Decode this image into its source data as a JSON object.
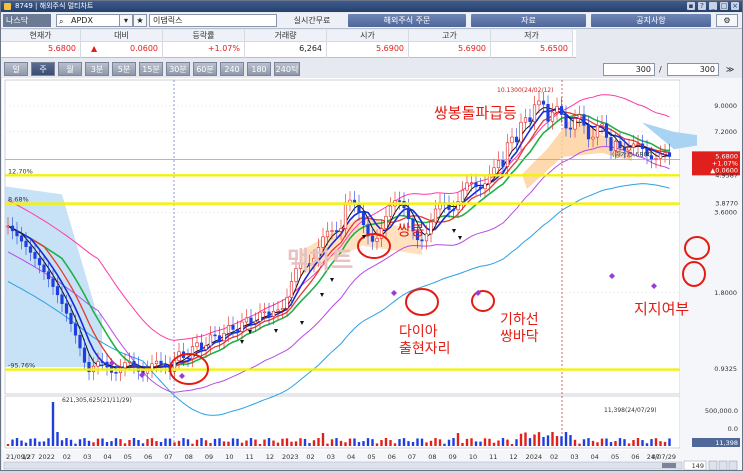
{
  "window": {
    "title": "8749 | 해외주식 멀티차트"
  },
  "toolbar": {
    "market": "나스닥",
    "symbol": "APDX",
    "name": "이댑릭스",
    "realtime_label": "실시간무료",
    "order_label": "해외주식 주문",
    "data_label": "자료",
    "notice_label": "공지사항"
  },
  "quote": {
    "headers": [
      "현재가",
      "대비",
      "등락률",
      "거래량",
      "시가",
      "고가",
      "저가"
    ],
    "values": [
      "5.6800",
      "0.0600",
      "+1.07%",
      "6,264",
      "5.6900",
      "5.6900",
      "5.6500"
    ]
  },
  "timeframes": [
    "일",
    "주",
    "월",
    "3분",
    "5분",
    "15분",
    "30분",
    "60분",
    "240분",
    "180틱",
    "240틱"
  ],
  "active_timeframe": "주",
  "count": {
    "left": "300",
    "sep": "/",
    "right": "300"
  },
  "chart": {
    "price_ticks": [
      "9.0000",
      "7.2000",
      "3.6000",
      "1.8000",
      "0.9325"
    ],
    "current_label": "5.6800",
    "current_label_2": "+1.07%",
    "current_label_3": "▲0.0600",
    "closing_note": "(종가)5.6800",
    "high_note": "10.1300(24/02/12)",
    "level_a": "4.9587",
    "level_b": "3.8770",
    "pct_top": "12.70%",
    "pct_mid": "8.68%",
    "pct_low": "-95.76%",
    "volume_ticks": [
      "500,000.0",
      "0.0"
    ],
    "volume_top_note": "621,305,625(21/11/29)",
    "volume_right_note": "11,398(24/07/29)",
    "volume_current": "11,398",
    "x_labels": [
      "21/09/27",
      "12",
      "2022",
      "02",
      "03",
      "04",
      "05",
      "06",
      "07",
      "08",
      "09",
      "10",
      "11",
      "12",
      "2023",
      "02",
      "03",
      "04",
      "05",
      "06",
      "07",
      "08",
      "09",
      "10",
      "11",
      "12",
      "2024",
      "02",
      "03",
      "04",
      "05",
      "06",
      "07",
      "24/07/29"
    ],
    "page_value": "149",
    "watermark": "맥차트",
    "annotations": {
      "surge": "쌍봉돌파급등",
      "double_top": "쌍봉",
      "diamond": "다이아\n출현자리",
      "double_bottom": "기하선\n쌍바닥",
      "support": "지지여부"
    },
    "colors": {
      "up": "#e0201c",
      "down": "#1e3ee0",
      "annotation": "#e41b12",
      "highlight": "#f2f20a"
    }
  }
}
